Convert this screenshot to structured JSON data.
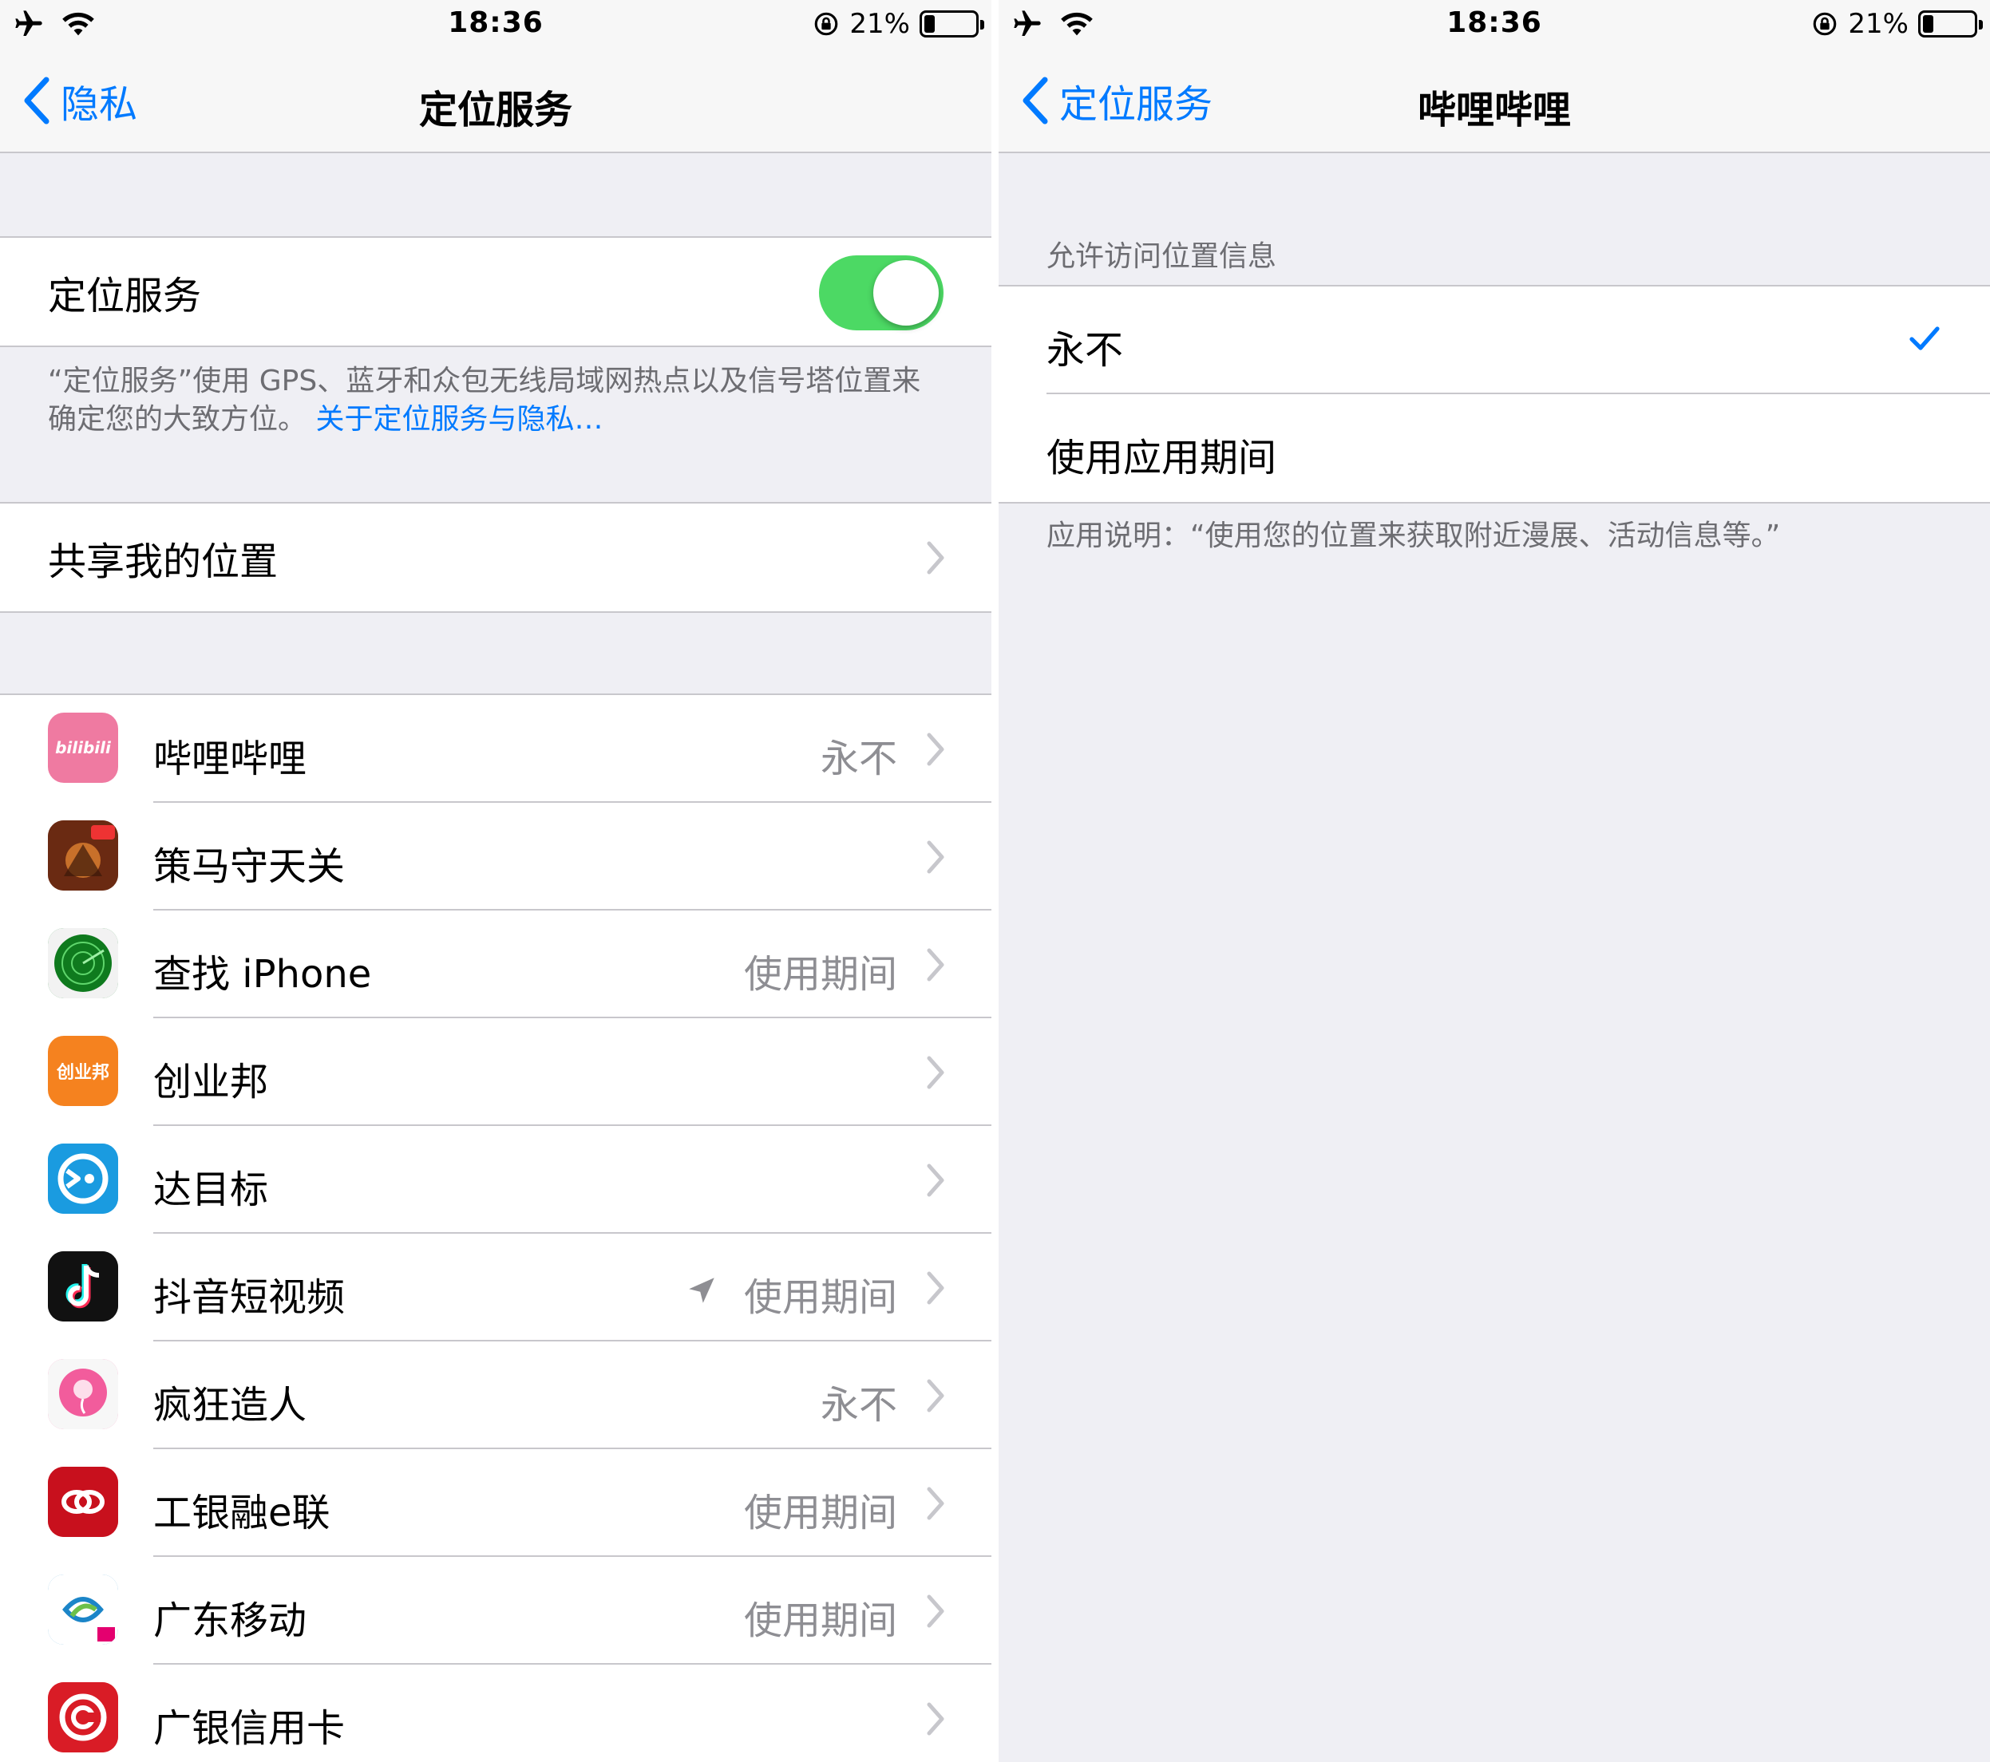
{
  "status_bar": {
    "time": "18:36",
    "battery": "21%",
    "battery_level": 0.21
  },
  "left": {
    "nav": {
      "back_label": "隐私",
      "title": "定位服务"
    },
    "location_services": {
      "label": "定位服务",
      "enabled": true
    },
    "footer": {
      "text": "“定位服务”使用 GPS、蓝牙和众包无线局域网热点以及信号塔位置来确定您的大致方位。",
      "link": "关于定位服务与隐私…"
    },
    "share": {
      "label": "共享我的位置"
    },
    "apps": [
      {
        "name": "哔哩哔哩",
        "status": "永不",
        "icon": "bilibili-icon",
        "color": "#ef7aa1"
      },
      {
        "name": "策马守天关",
        "status": "",
        "icon": "game-icon",
        "color": "#8a3b1e"
      },
      {
        "name": "查找 iPhone",
        "status": "使用期间",
        "icon": "find-iphone-icon",
        "color": "#1a8a2e"
      },
      {
        "name": "创业邦",
        "status": "",
        "icon": "cyzone-icon",
        "color": "#f5821f"
      },
      {
        "name": "达目标",
        "status": "",
        "icon": "target-icon",
        "color": "#1a9be0"
      },
      {
        "name": "抖音短视频",
        "status": "使用期间",
        "icon": "tiktok-icon",
        "color": "#111111"
      },
      {
        "name": "疯狂造人",
        "status": "永不",
        "icon": "sperm-icon",
        "color": "#f25c9c"
      },
      {
        "name": "工银融e联",
        "status": "使用期间",
        "icon": "icbc-icon",
        "color": "#c8101d"
      },
      {
        "name": "广东移动",
        "status": "使用期间",
        "icon": "china-mobile-icon",
        "color": "#1b85c8"
      },
      {
        "name": "广银信用卡",
        "status": "",
        "icon": "cgb-icon",
        "color": "#d91c26"
      }
    ],
    "app_icon_texts": {
      "bilibili": "bilibili",
      "cyzone": "创业邦"
    }
  },
  "right": {
    "nav": {
      "back_label": "定位服务",
      "title": "哔哩哔哩"
    },
    "section_header": "允许访问位置信息",
    "options": [
      {
        "label": "永不",
        "selected": true
      },
      {
        "label": "使用应用期间",
        "selected": false
      }
    ],
    "description": "应用说明：“使用您的位置来获取附近漫展、活动信息等。”"
  },
  "colors": {
    "accent": "#007aff",
    "toggle_on": "#4cd964",
    "background": "#efeff4",
    "secondary_text": "#8e8e93"
  }
}
